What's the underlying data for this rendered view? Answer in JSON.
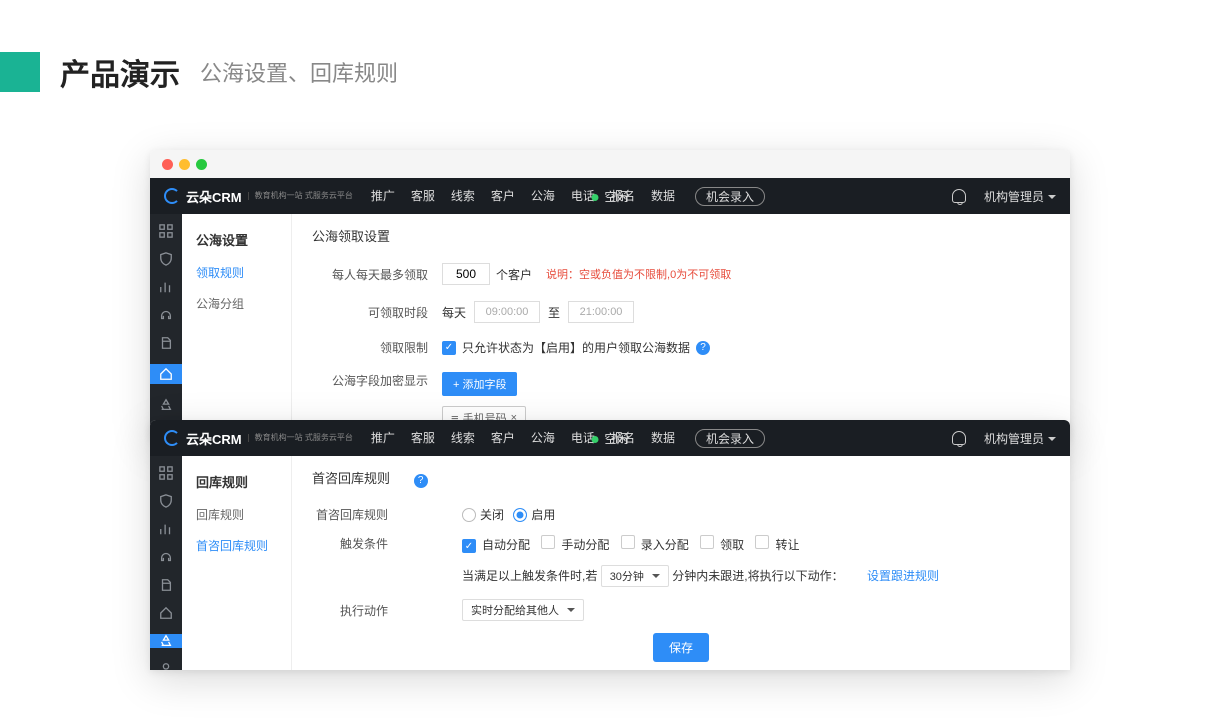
{
  "slide": {
    "title": "产品演示",
    "subtitle": "公海设置、回库规则"
  },
  "topnav": [
    "推广",
    "客服",
    "线索",
    "客户",
    "公海",
    "电话",
    "报名",
    "数据"
  ],
  "topnav_pill": "机会录入",
  "status": "空闲",
  "role": "机构管理员",
  "logo": "云朵CRM",
  "logo_sub": "教育机构一站\n式服务云平台",
  "win1": {
    "sidebar_title": "公海设置",
    "sidebar_items": [
      "领取规则",
      "公海分组"
    ],
    "section_title": "公海领取设置",
    "row1": {
      "label": "每人每天最多领取",
      "value": "500",
      "unit": "个客户",
      "note_prefix": "说明：",
      "note": "空或负值为不限制,0为不可领取"
    },
    "row2": {
      "label": "可领取时段",
      "daily": "每天",
      "from": "09:00:00",
      "to_label": "至",
      "to": "21:00:00"
    },
    "row3": {
      "label": "领取限制",
      "text": "只允许状态为【启用】的用户领取公海数据"
    },
    "row4": {
      "label": "公海字段加密显示",
      "btn": "+ 添加字段",
      "tag": "手机号码"
    }
  },
  "win2": {
    "sidebar_title": "回库规则",
    "sidebar_items": [
      "回库规则",
      "首咨回库规则"
    ],
    "section_title": "首咨回库规则",
    "rule_label": "首咨回库规则",
    "radio_off": "关闭",
    "radio_on": "启用",
    "trigger_label": "触发条件",
    "triggers": [
      "自动分配",
      "手动分配",
      "录入分配",
      "领取",
      "转让"
    ],
    "desc_a": "当满足以上触发条件时,若",
    "select_minutes": "30分钟",
    "desc_b": "分钟内未跟进,将执行以下动作：",
    "link_rule": "设置跟进规则",
    "exec_label": "执行动作",
    "exec_select": "实时分配给其他人",
    "save": "保存"
  }
}
